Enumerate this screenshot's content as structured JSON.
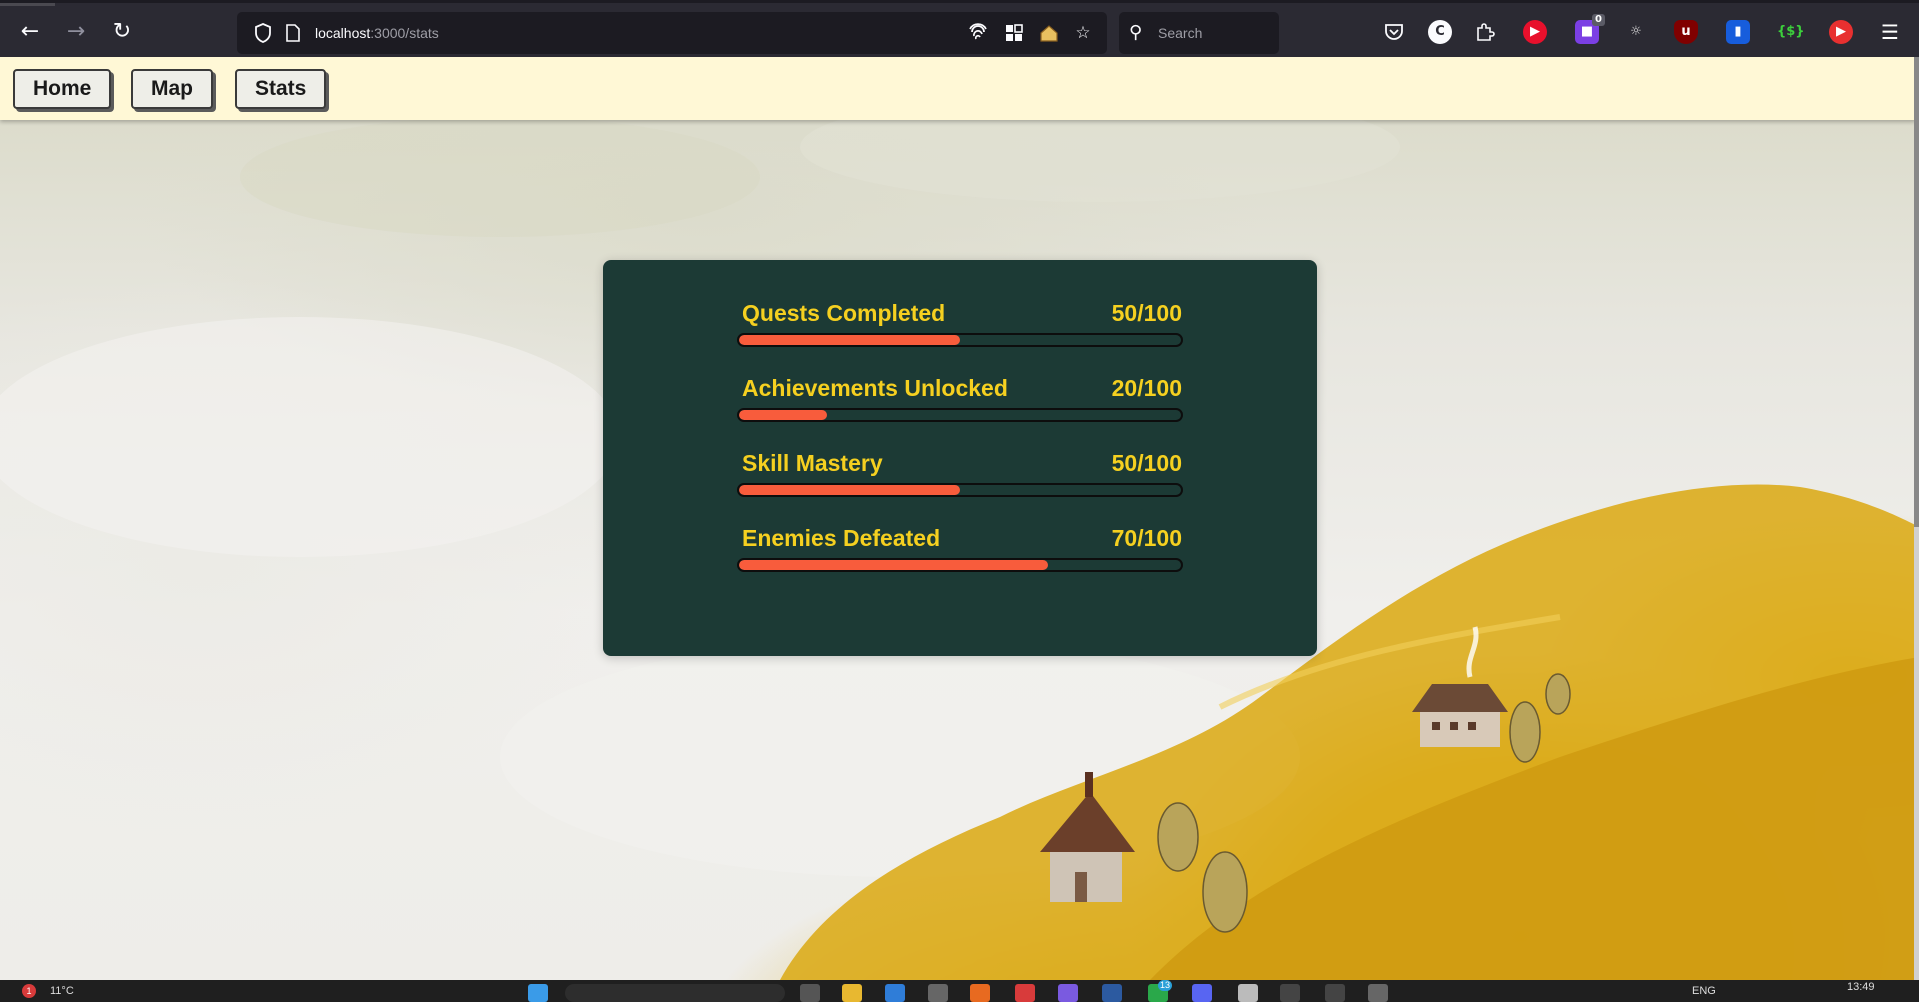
{
  "browser": {
    "url_host": "localhost",
    "url_path": ":3000/stats",
    "search_placeholder": "Search",
    "ext_badge_count": "0"
  },
  "nav": {
    "home_label": "Home",
    "map_label": "Map",
    "stats_label": "Stats"
  },
  "stats": [
    {
      "label": "Quests Completed",
      "value_text": "50/100",
      "progress": 0.5
    },
    {
      "label": "Achievements Unlocked",
      "value_text": "20/100",
      "progress": 0.2
    },
    {
      "label": "Skill Mastery",
      "value_text": "50/100",
      "progress": 0.5
    },
    {
      "label": "Enemies Defeated",
      "value_text": "70/100",
      "progress": 0.7
    }
  ],
  "colors": {
    "card_bg": "#1c3a35",
    "label_yellow": "#f5d020",
    "bar_fill": "#f85c3c",
    "nav_bg": "#fff8d6"
  },
  "taskbar": {
    "weather": "11°C",
    "notif_badge": "1",
    "language": "ENG",
    "time": "13:49",
    "app_badge": "13"
  }
}
